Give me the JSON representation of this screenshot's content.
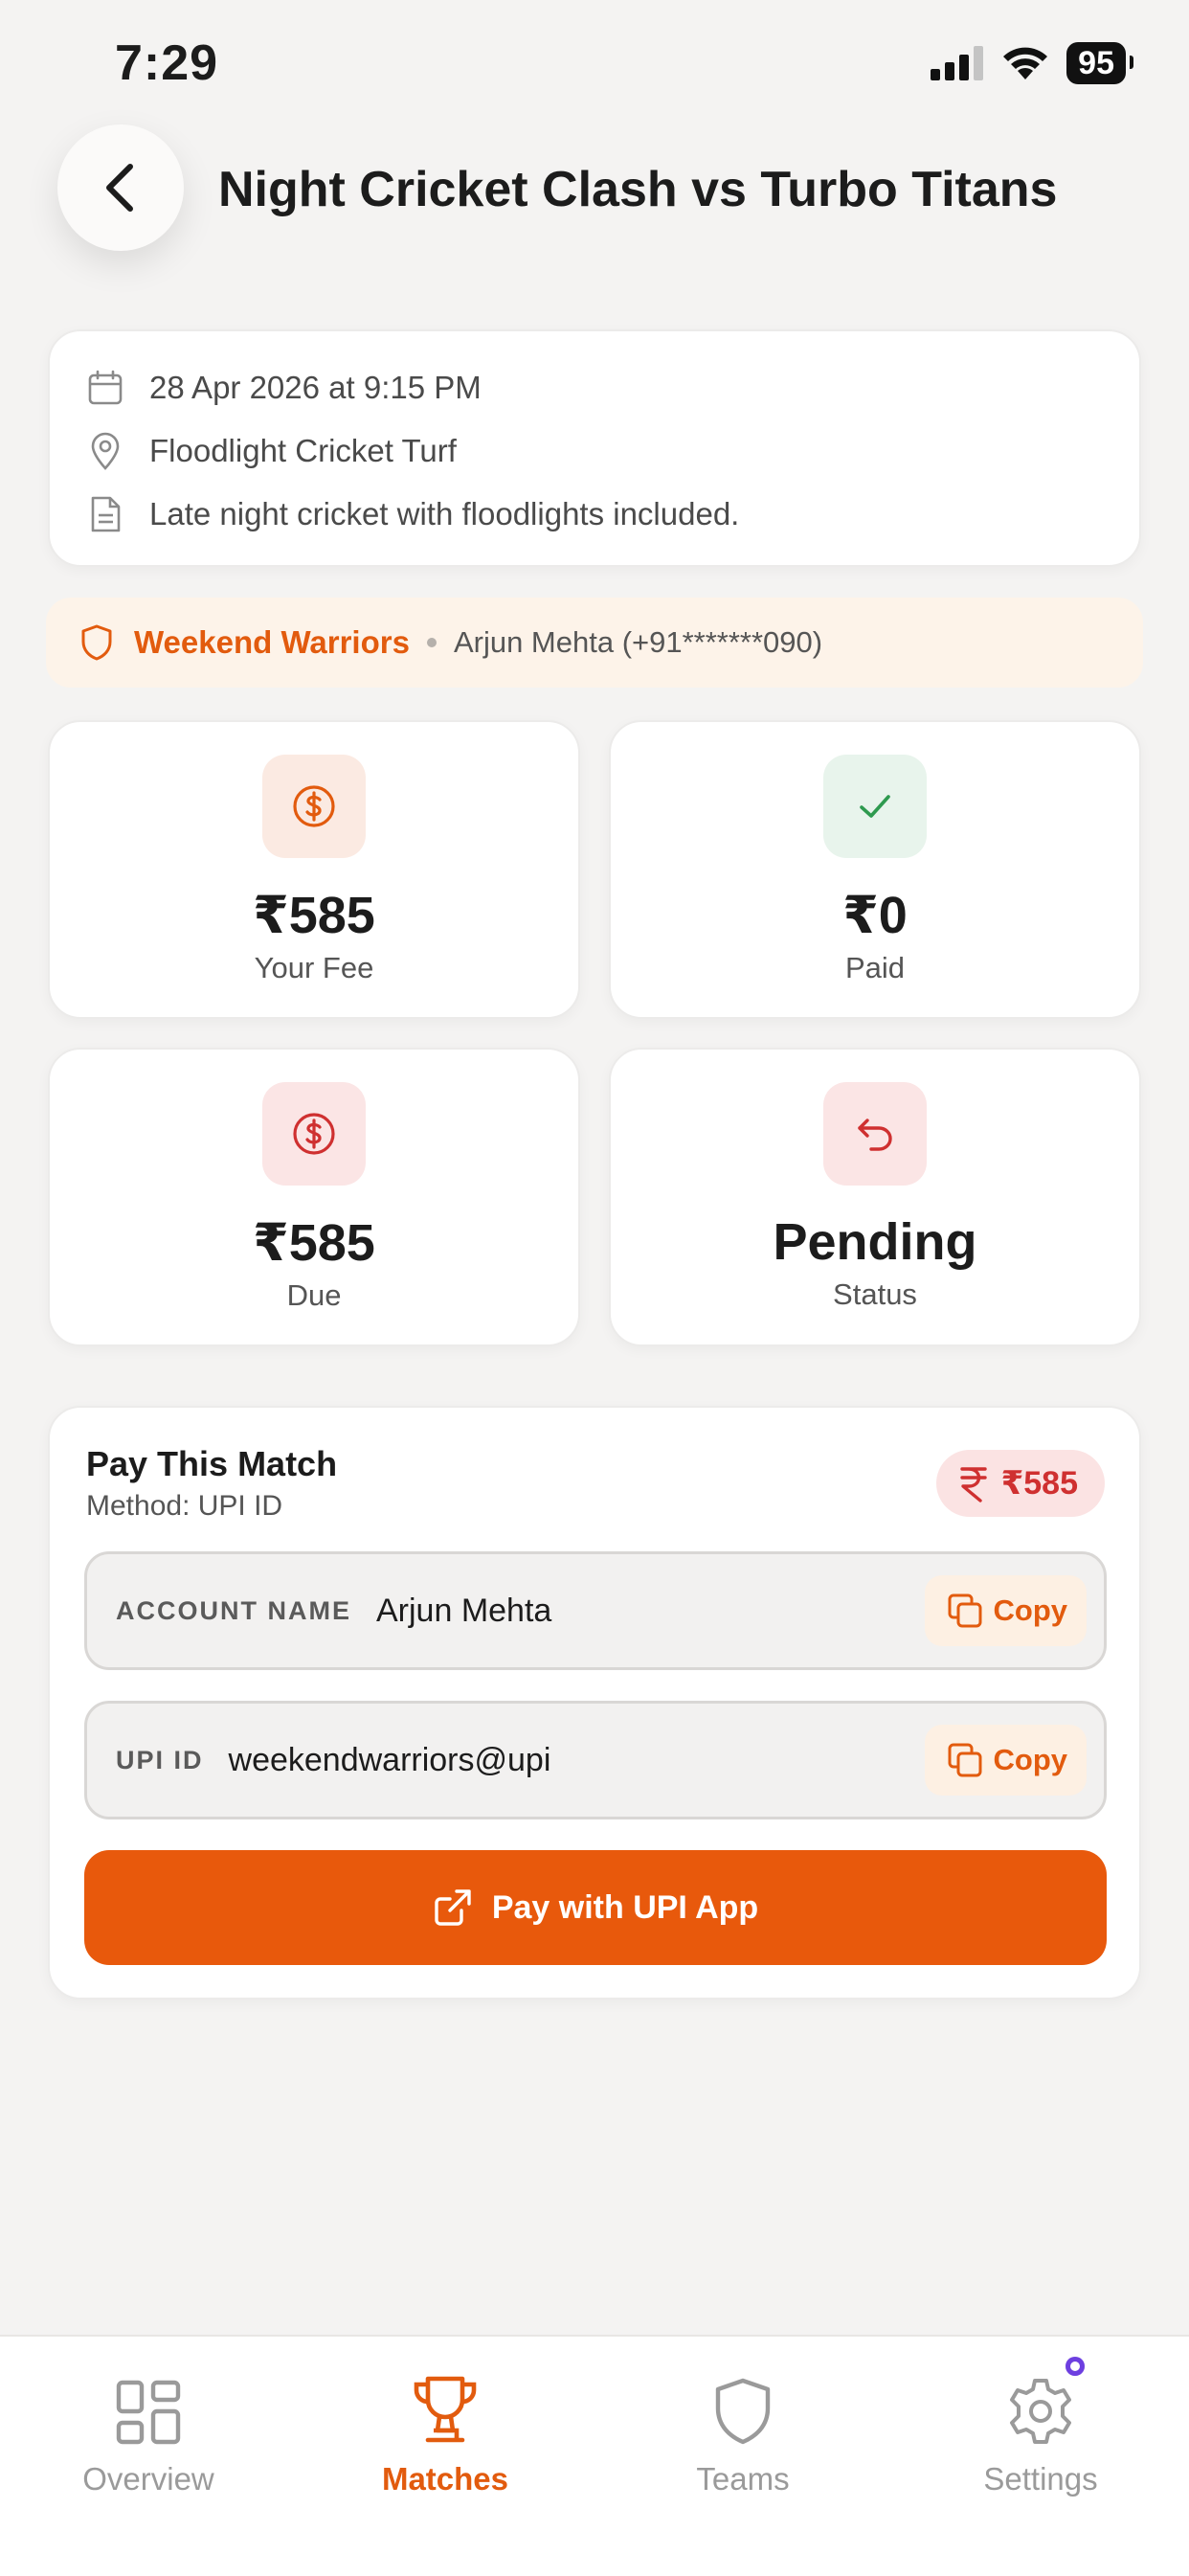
{
  "status_bar": {
    "time": "7:29",
    "battery": "95"
  },
  "header": {
    "title": "Night Cricket Clash vs Turbo Titans"
  },
  "match_info": {
    "datetime": "28 Apr 2026 at 9:15 PM",
    "venue": "Floodlight Cricket Turf",
    "notes": "Late night cricket with floodlights included."
  },
  "team": {
    "name": "Weekend Warriors",
    "contact": "Arjun Mehta (+91*******090)"
  },
  "stats": {
    "fee": {
      "value": "₹585",
      "label": "Your Fee"
    },
    "paid": {
      "value": "₹0",
      "label": "Paid"
    },
    "due": {
      "value": "₹585",
      "label": "Due"
    },
    "status": {
      "value": "Pending",
      "label": "Status"
    }
  },
  "payment": {
    "title": "Pay This Match",
    "method": "Method: UPI ID",
    "amount": "₹585",
    "account_label": "ACCOUNT NAME",
    "account_value": "Arjun Mehta",
    "upi_label": "UPI ID",
    "upi_value": "weekendwarriors@upi",
    "copy_label": "Copy",
    "pay_button": "Pay with UPI App"
  },
  "nav": {
    "items": [
      {
        "label": "Overview"
      },
      {
        "label": "Matches"
      },
      {
        "label": "Teams"
      },
      {
        "label": "Settings"
      }
    ],
    "active": "Matches"
  },
  "colors": {
    "accent": "#e8590c",
    "accent_text": "#e25b0e",
    "danger": "#cf3030",
    "success": "#2e9a4f"
  }
}
